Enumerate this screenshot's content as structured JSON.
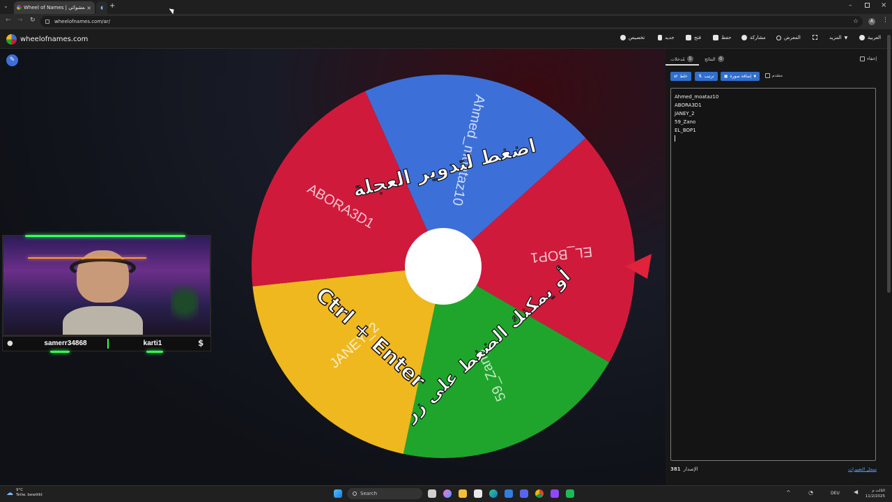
{
  "browser": {
    "tab_title": "Wheel of Names | إسم العشوائي",
    "url": "wheelofnames.com/ar/",
    "profile_initial": "A"
  },
  "app": {
    "logo_text": "wheelofnames.com",
    "menu": {
      "customize": "تخصيص",
      "new": "جديد",
      "open": "فتح",
      "save": "حفظ",
      "share": "مشاركة",
      "gallery": "المعرض",
      "more": "المزيد",
      "language": "العربية"
    }
  },
  "wheel": {
    "segments": [
      {
        "name": "Ahmed_moataz10",
        "color": "#3d6fd8"
      },
      {
        "name": "EL_BOP1",
        "color": "#d01a3c"
      },
      {
        "name": "59_Zano",
        "color": "#1fa52b"
      },
      {
        "name": "JANEY_2",
        "color": "#f0b81f"
      },
      {
        "name": "ABORA3D1",
        "color": "#d01a3c"
      }
    ],
    "overlay_top": "اضغط لتدوير العجلة",
    "overlay_bottom_line1": "أو يمكنك الضغط على زر",
    "overlay_bottom_line2": "Ctrl + Enter",
    "pointer_color": "#e0223a"
  },
  "panel": {
    "hide_label": "إخفاء",
    "tab_entries_label": "مُدخلات",
    "tab_entries_count": "5",
    "tab_results_label": "النتائج",
    "tab_results_count": "0",
    "shuffle_label": "خلط",
    "sort_label": "ترتيب",
    "add_image_label": "إضافة صورة",
    "advanced_label": "متقدم",
    "entries": [
      "Ahmed_moataz10",
      "ABORA3D1",
      "JANEY_2",
      "59_Zano",
      "EL_BOP1"
    ],
    "version_label": "الإصدار",
    "version_number": "381",
    "changelog_link": "سجل التغييرات"
  },
  "stream": {
    "left_name": "samerr34868",
    "right_name": "karti1"
  },
  "taskbar": {
    "weather_temp": "9°C",
    "weather_desc": "Teilw. bewölkt",
    "search_placeholder": "Search",
    "language": "DEU",
    "time": "الثالث م",
    "date": "11/2/2025"
  }
}
